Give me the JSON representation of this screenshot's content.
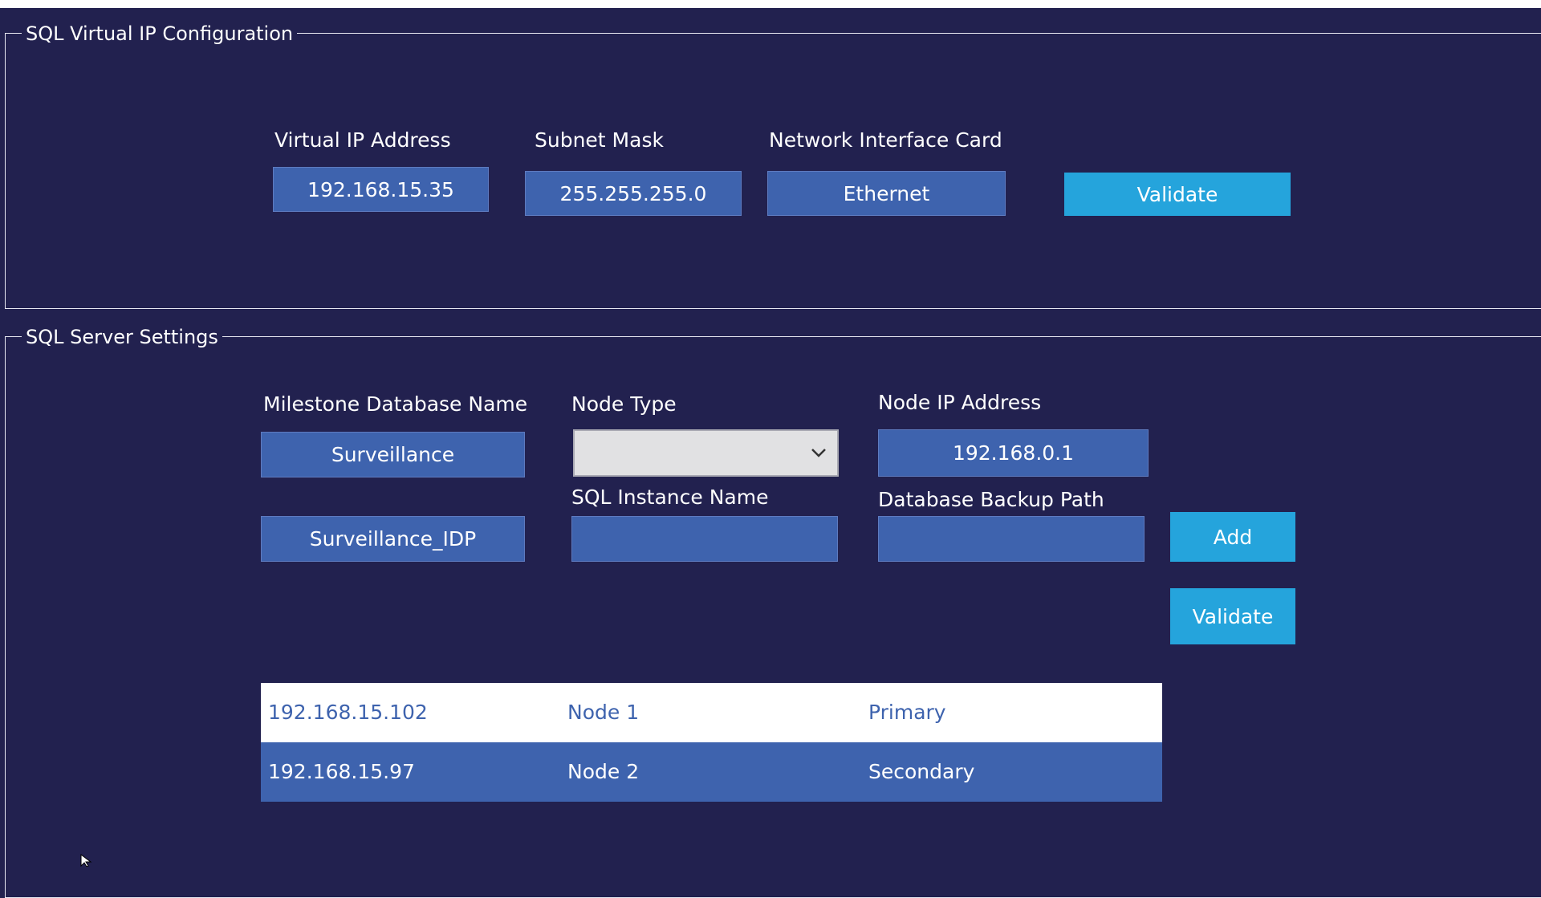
{
  "vip_section": {
    "legend": "SQL Virtual IP Configuration",
    "labels": {
      "virtual_ip": "Virtual IP Address",
      "subnet": "Subnet Mask",
      "nic": "Network Interface Card"
    },
    "values": {
      "virtual_ip": "192.168.15.35",
      "subnet": "255.255.255.0",
      "nic": "Ethernet"
    },
    "validate_label": "Validate"
  },
  "sql_section": {
    "legend": "SQL Server Settings",
    "labels": {
      "db_name": "Milestone Database Name",
      "node_type": "Node Type",
      "node_ip": "Node IP Address",
      "instance": "SQL Instance Name",
      "backup": "Database Backup Path"
    },
    "values": {
      "db_name_1": "Surveillance",
      "db_name_2": "Surveillance_IDP",
      "node_type": "",
      "node_ip": "192.168.0.1",
      "instance": "",
      "backup": ""
    },
    "add_label": "Add",
    "validate_label": "Validate",
    "nodes": [
      {
        "ip": "192.168.15.102",
        "name": "Node 1",
        "role": "Primary"
      },
      {
        "ip": "192.168.15.97",
        "name": "Node 2",
        "role": "Secondary"
      }
    ]
  },
  "colors": {
    "background": "#22214f",
    "field": "#3e63ae",
    "button": "#25a4dc",
    "selected_row": "#ffffff"
  },
  "icons": [
    "chevron-down-icon",
    "mouse-cursor-icon"
  ]
}
